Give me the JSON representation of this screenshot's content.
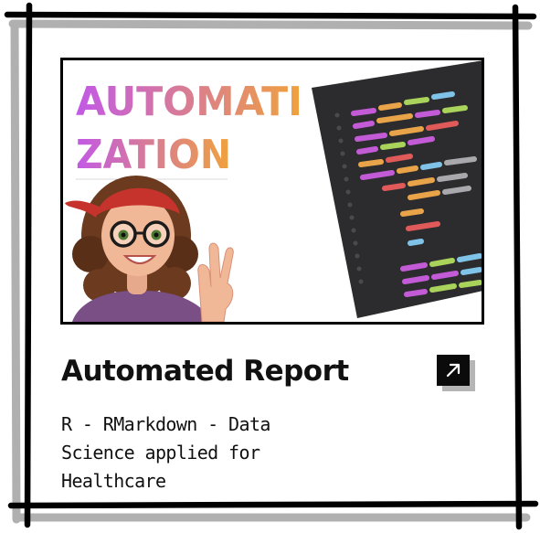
{
  "card": {
    "thumbnail": {
      "headline_line1": "AUTOMATI",
      "headline_line2": "ZATION",
      "gradient_start": "#c259e6",
      "gradient_end": "#f0a23c",
      "editor_color": "#2c2c2e"
    },
    "title": "Automated Report",
    "description": "R - RMarkdown - Data Science applied for Healthcare",
    "link_icon": "arrow-up-right-icon"
  },
  "colors": {
    "border": "#000000",
    "shadow": "#b5b5b5",
    "button_bg": "#0b0b0b"
  }
}
